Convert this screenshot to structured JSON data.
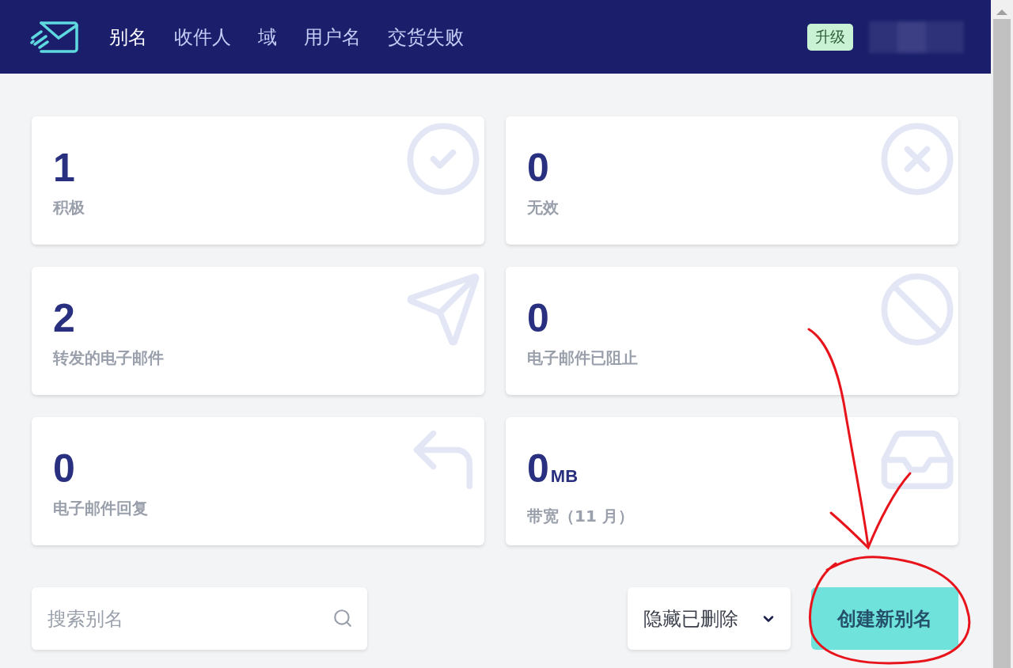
{
  "nav": {
    "tabs": [
      {
        "label": "别名",
        "selected": true
      },
      {
        "label": "收件人",
        "selected": false
      },
      {
        "label": "域",
        "selected": false
      },
      {
        "label": "用户名",
        "selected": false
      },
      {
        "label": "交货失败",
        "selected": false
      }
    ],
    "upgrade": "升级"
  },
  "stats": [
    {
      "kind": "check",
      "value": "1",
      "label": "积极"
    },
    {
      "kind": "cross",
      "value": "0",
      "label": "无效"
    },
    {
      "kind": "send",
      "value": "2",
      "label": "转发的电子邮件"
    },
    {
      "kind": "block",
      "value": "0",
      "label": "电子邮件已阻止"
    },
    {
      "kind": "reply",
      "value": "0",
      "label": "电子邮件回复"
    },
    {
      "kind": "inbox",
      "value": "0",
      "unit": "MB",
      "label": "带宽（11 月）"
    }
  ],
  "search": {
    "placeholder": "搜索别名"
  },
  "filter": {
    "label": "隐藏已删除"
  },
  "create_button": "创建新别名"
}
